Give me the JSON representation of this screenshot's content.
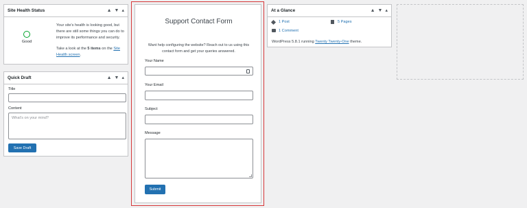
{
  "site_health": {
    "title": "Site Health Status",
    "status": "Good",
    "message": "Your site's health is looking good, but there are still some things you can do to improve its performance and security.",
    "items_prefix": "Take a look at the ",
    "items_bold": "5 items",
    "items_mid": " on the ",
    "items_link": "Site Health screen",
    "items_suffix": "."
  },
  "quick_draft": {
    "title": "Quick Draft",
    "title_label": "Title",
    "content_label": "Content",
    "content_placeholder": "What's on your mind?",
    "save_label": "Save Draft"
  },
  "contact_form": {
    "heading": "Support Contact Form",
    "intro": "Want help configuring the website? Reach out to us using this contact form and get your queries answered.",
    "name_label": "Your Name",
    "email_label": "Your Email",
    "subject_label": "Subject",
    "message_label": "Message",
    "submit_label": "Submit",
    "accent": "#d63638"
  },
  "at_a_glance": {
    "title": "At a Glance",
    "posts": "1 Post",
    "pages": "5 Pages",
    "comments": "1 Comment",
    "wp_prefix": "WordPress 5.8.1 running ",
    "theme_link": "Twenty Twenty-One",
    "wp_suffix": " theme."
  },
  "controls": {
    "up": "▲",
    "down": "▼",
    "toggle": "▴"
  },
  "colors": {
    "primary": "#2271b1",
    "good": "#00a32a"
  }
}
